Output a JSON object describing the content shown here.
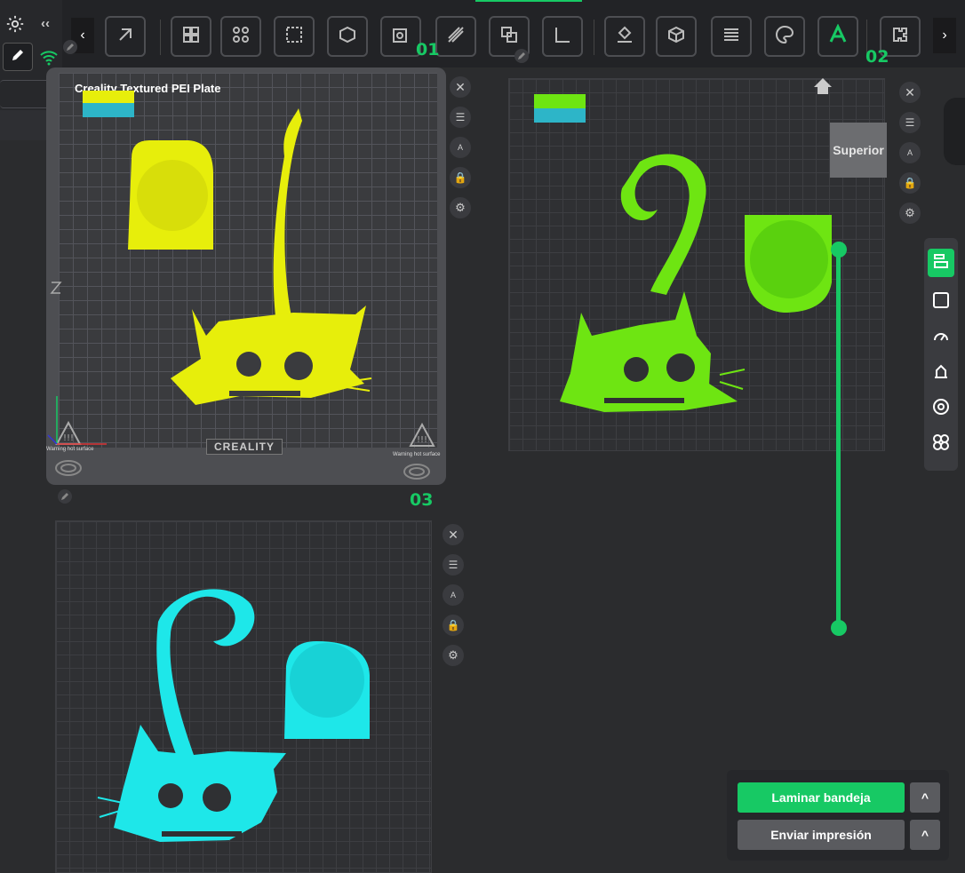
{
  "toolbar": {
    "tools": [
      "add-plate-icon",
      "arrange-icon",
      "orient-icon",
      "auto-fit-icon",
      "cube-icon",
      "mesh-cube-icon",
      "slice-icon",
      "boolean-icon",
      "measure-icon",
      "support-painting-icon",
      "hollow-cube-icon",
      "layers-icon",
      "color-paint-icon",
      "text-icon",
      "assembly-icon"
    ],
    "prev_label": "‹",
    "next_label": "›"
  },
  "plates": [
    {
      "number": "01",
      "label": "Creality Textured PEI Plate",
      "brand": "CREALITY",
      "color": "#e7ee0b",
      "warning": "Warning hot surface"
    },
    {
      "number": "02",
      "color": "#6ee512"
    },
    {
      "number": "03",
      "color": "#1ee7e9"
    }
  ],
  "view": {
    "label": "Superior"
  },
  "slider": {
    "range_start": 0,
    "range_end": 1
  },
  "actions": {
    "slice_label": "Laminar bandeja",
    "send_label": "Enviar impresión",
    "caret": "^"
  },
  "colors": {
    "accent": "#17c964",
    "yellow": "#e7ee0b",
    "green": "#6ee512",
    "cyan": "#1ee7e9"
  }
}
